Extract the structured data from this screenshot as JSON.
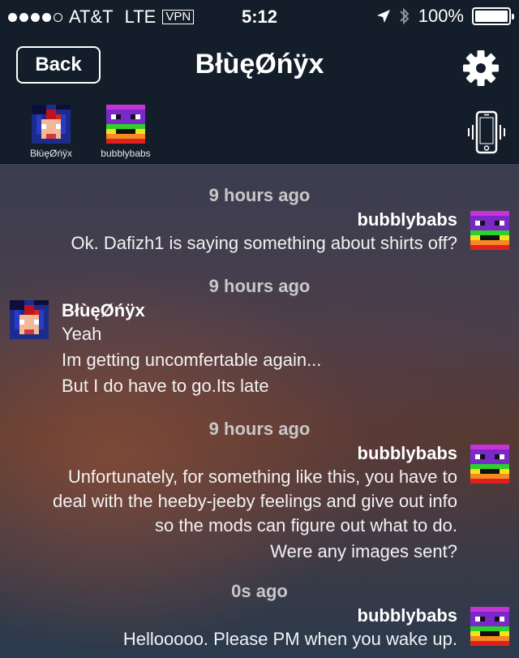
{
  "status_bar": {
    "carrier": "AT&T",
    "network": "LTE",
    "vpn": "VPN",
    "time": "5:12",
    "battery": "100%"
  },
  "nav": {
    "back_label": "Back",
    "title": "BłùęØńÿx"
  },
  "participants": [
    {
      "name": "BłùęØńÿx"
    },
    {
      "name": "bubblybabs"
    }
  ],
  "messages": [
    {
      "timestamp": "9 hours ago",
      "sender": "bubblybabs",
      "side": "right",
      "lines": [
        "Ok.  Dafizh1 is saying something about shirts off?"
      ]
    },
    {
      "timestamp": "9 hours ago",
      "sender": "BłùęØńÿx",
      "side": "left",
      "lines": [
        "Yeah",
        "Im getting uncomfertable again...",
        "But I do have to go.Its late"
      ]
    },
    {
      "timestamp": "9 hours ago",
      "sender": "bubblybabs",
      "side": "right",
      "lines": [
        "Unfortunately, for something like this, you have to",
        "deal with the heeby-jeeby feelings and give out info",
        "so the mods can figure out what to do.",
        "Were any images sent?"
      ]
    },
    {
      "timestamp": "0s ago",
      "sender": "bubblybabs",
      "side": "right",
      "lines": [
        "Hellooooo.  Please PM when you wake up."
      ]
    }
  ],
  "icons": {
    "settings": "gear-icon",
    "ringer": "vibrate-phone-icon",
    "location": "location-arrow-icon",
    "bluetooth": "bluetooth-icon"
  },
  "colors": {
    "bar_background": "#141e2b",
    "timestamp": "#c8c8c8"
  }
}
